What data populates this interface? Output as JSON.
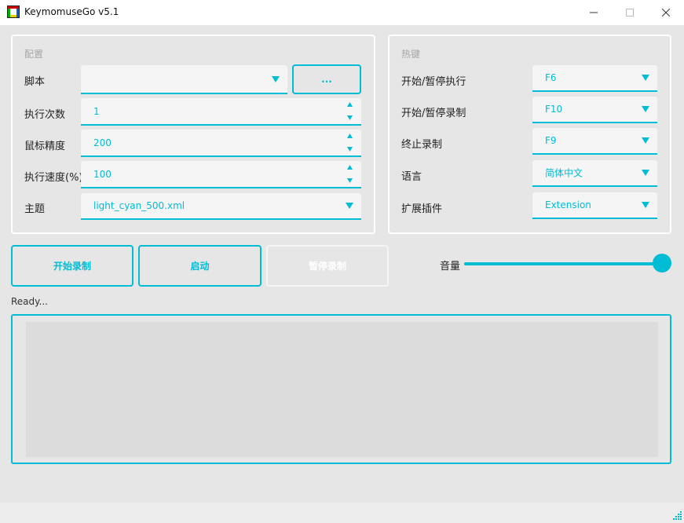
{
  "window": {
    "title": "KeymomuseGo v5.1"
  },
  "config": {
    "title": "配置",
    "script_label": "脚本",
    "script_value": "",
    "browse_button": "...",
    "run_times_label": "执行次数",
    "run_times_value": "1",
    "mouse_precision_label": "鼠标精度",
    "mouse_precision_value": "200",
    "run_speed_label": "执行速度(%)",
    "run_speed_value": "100",
    "theme_label": "主题",
    "theme_value": "light_cyan_500.xml"
  },
  "hotkeys": {
    "title": "热键",
    "start_pause_run_label": "开始/暂停执行",
    "start_pause_run_value": "F6",
    "start_pause_record_label": "开始/暂停录制",
    "start_pause_record_value": "F10",
    "stop_record_label": "终止录制",
    "stop_record_value": "F9",
    "language_label": "语言",
    "language_value": "简体中文",
    "plugin_label": "扩展插件",
    "plugin_value": "Extension"
  },
  "actions": {
    "start_record": "开始录制",
    "launch": "启动",
    "pause_record": "暂停录制"
  },
  "volume": {
    "label": "音量",
    "level": 1.0
  },
  "status_text": "Ready...",
  "log_text": "",
  "colors": {
    "accent": "#00bcd4",
    "background": "#e6e6e6",
    "field": "#f5f5f5"
  }
}
